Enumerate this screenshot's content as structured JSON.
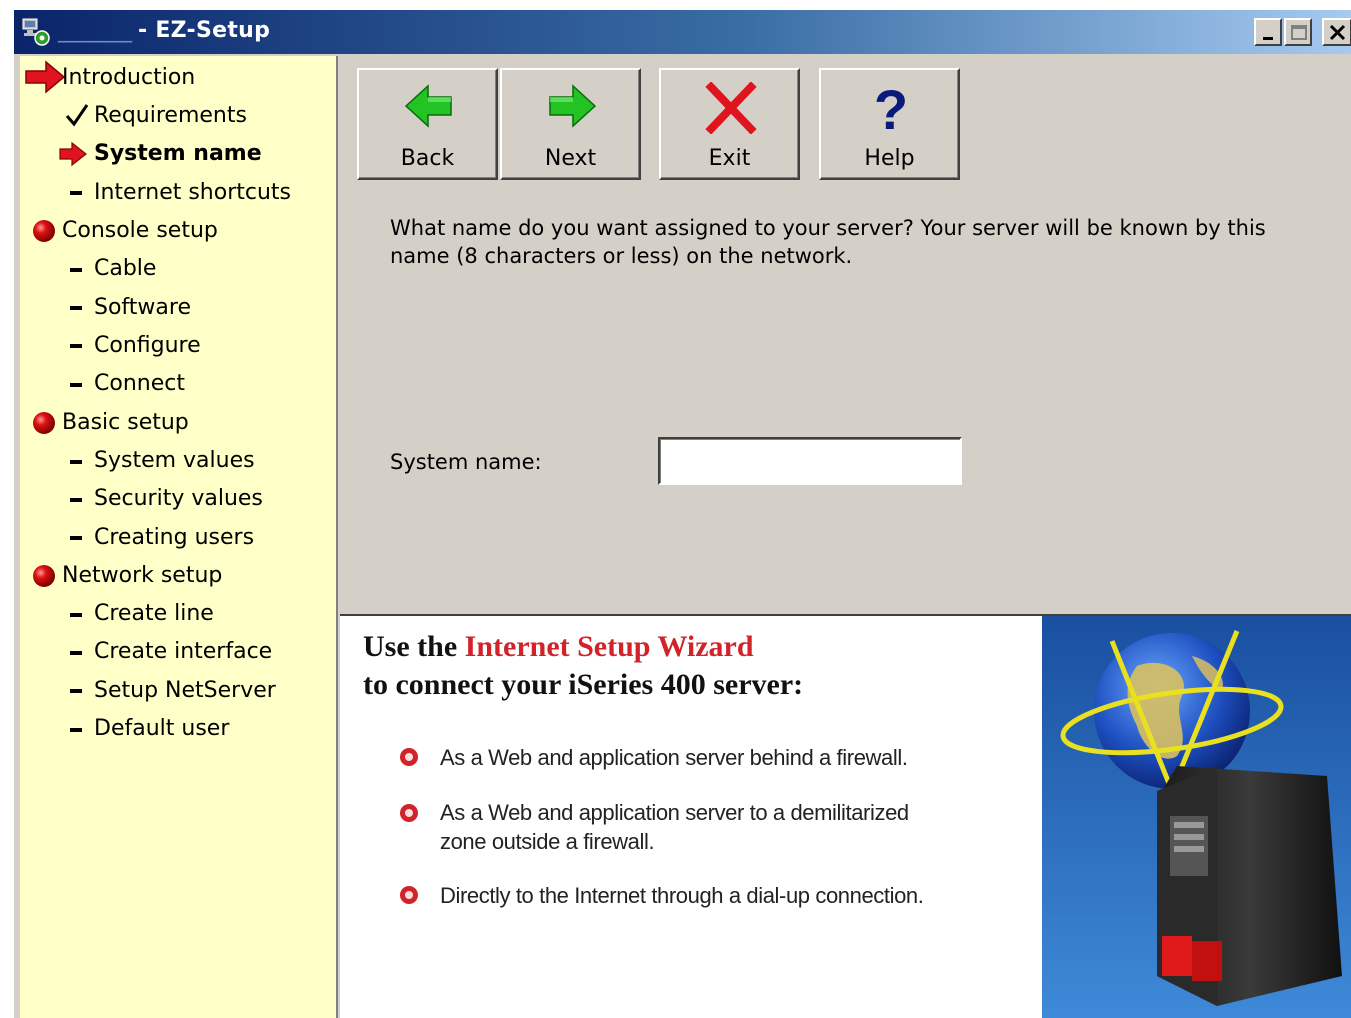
{
  "window": {
    "title": "- EZ-Setup",
    "title_masked_prefix": "________"
  },
  "colors": {
    "titlebar_start": "#0a246a",
    "titlebar_end": "#a6caf0",
    "sidebar_bg": "#ffffc8",
    "panel_bg": "#d4d0c8",
    "accent_red": "#d2232a",
    "arrow_green": "#22c322"
  },
  "sidebar": {
    "items": [
      {
        "label": "Introduction",
        "level": 0,
        "marker": "big-red-arrow-icon"
      },
      {
        "label": "Requirements",
        "level": 1,
        "marker": "checkmark-icon"
      },
      {
        "label": "System name",
        "level": 1,
        "marker": "red-arrow-icon",
        "current": true
      },
      {
        "label": "Internet shortcuts",
        "level": 1,
        "marker": "dash-icon"
      },
      {
        "label": "Console setup",
        "level": 0,
        "marker": "red-ball-icon"
      },
      {
        "label": "Cable",
        "level": 1,
        "marker": "dash-icon"
      },
      {
        "label": "Software",
        "level": 1,
        "marker": "dash-icon"
      },
      {
        "label": "Configure",
        "level": 1,
        "marker": "dash-icon"
      },
      {
        "label": "Connect",
        "level": 1,
        "marker": "dash-icon"
      },
      {
        "label": "Basic setup",
        "level": 0,
        "marker": "red-ball-icon"
      },
      {
        "label": "System values",
        "level": 1,
        "marker": "dash-icon"
      },
      {
        "label": "Security values",
        "level": 1,
        "marker": "dash-icon"
      },
      {
        "label": "Creating users",
        "level": 1,
        "marker": "dash-icon"
      },
      {
        "label": "Network setup",
        "level": 0,
        "marker": "red-ball-icon"
      },
      {
        "label": "Create line",
        "level": 1,
        "marker": "dash-icon"
      },
      {
        "label": "Create interface",
        "level": 1,
        "marker": "dash-icon"
      },
      {
        "label": "Setup NetServer",
        "level": 1,
        "marker": "dash-icon"
      },
      {
        "label": "Default user",
        "level": 1,
        "marker": "dash-icon"
      }
    ]
  },
  "toolbar": {
    "back_label": "Back",
    "next_label": "Next",
    "exit_label": "Exit",
    "help_label": "Help"
  },
  "main": {
    "prompt": "What name do you want assigned to your server?  Your server will be known by this name (8 characters or less) on the network.",
    "system_name_label": "System name:",
    "system_name_value": ""
  },
  "banner": {
    "line1_prefix": "Use the",
    "line1_highlight": "Internet Setup Wizard",
    "line2": "to connect your iSeries 400 server:",
    "bullets": [
      "As a Web and application server behind a firewall.",
      "As a Web and application server to a demilitarized zone outside a firewall.",
      "Directly to the Internet through a dial-up connection."
    ]
  }
}
